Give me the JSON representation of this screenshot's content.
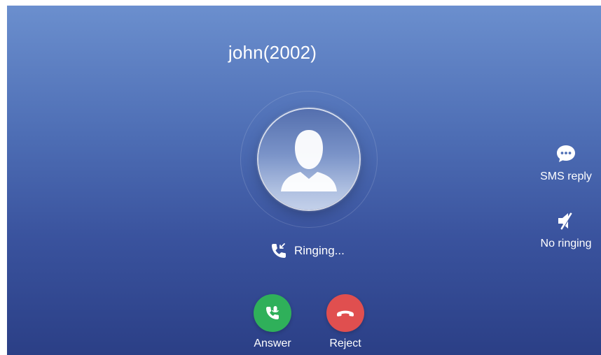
{
  "call": {
    "caller_name": "john(2002)",
    "status_text": "Ringing..."
  },
  "actions": {
    "answer_label": "Answer",
    "reject_label": "Reject"
  },
  "side_actions": {
    "sms_reply_label": "SMS reply",
    "no_ringing_label": "No ringing"
  },
  "icons": {
    "avatar": "person-silhouette-icon",
    "status": "incoming-call-icon",
    "answer": "phone-answer-icon",
    "reject": "phone-hangup-icon",
    "sms_reply": "chat-bubble-icon",
    "no_ringing": "speaker-mute-icon"
  },
  "colors": {
    "background_top": "#6b8fce",
    "background_bottom": "#2b3f86",
    "answer": "#2fb05a",
    "reject": "#e04f4f",
    "text": "#ffffff"
  }
}
